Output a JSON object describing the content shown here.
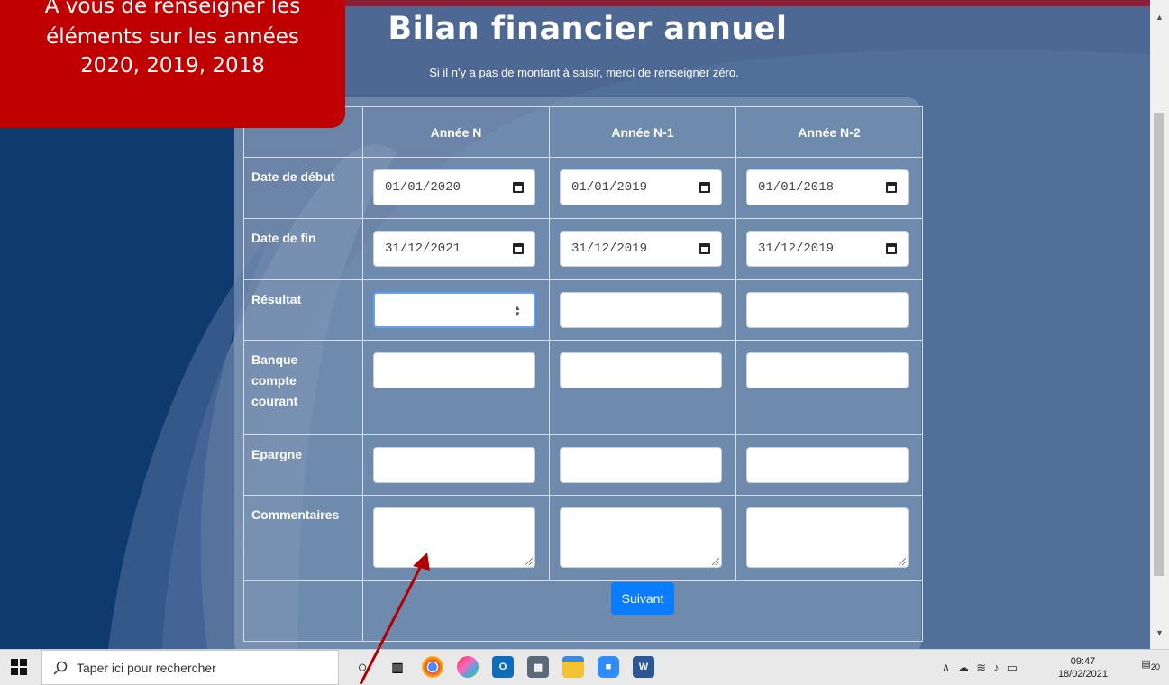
{
  "callout": {
    "lines": [
      "A vous de renseigner les",
      "éléments sur les années",
      "2020, 2019, 2018"
    ]
  },
  "page": {
    "title": "Bilan financier annuel",
    "subtitle": "Si il n'y a pas de montant à saisir, merci de renseigner zéro."
  },
  "table": {
    "headers": [
      "Année N",
      "Année N-1",
      "Année N-2"
    ],
    "rows": {
      "date_debut": {
        "label": "Date de début",
        "values": [
          "01/01/2020",
          "01/01/2019",
          "01/01/2018"
        ]
      },
      "date_fin": {
        "label": "Date de fin",
        "values": [
          "31/12/2021",
          "31/12/2019",
          "31/12/2019"
        ]
      },
      "resultat": {
        "label": "Résultat"
      },
      "banque": {
        "label": "Banque compte courant"
      },
      "epargne": {
        "label": "Epargne"
      },
      "commentaires": {
        "label": "Commentaires"
      }
    },
    "submit_label": "Suivant"
  },
  "taskbar": {
    "search_placeholder": "Taper ici pour rechercher",
    "time": "09:47",
    "date": "18/02/2021",
    "notifications": "20",
    "icons": [
      "windows-start-icon",
      "cortana-icon",
      "task-view-icon",
      "chrome-icon",
      "paint-icon",
      "outlook-icon",
      "calculator-icon",
      "file-explorer-icon",
      "zoom-icon",
      "word-icon"
    ]
  },
  "colors": {
    "accent": "#0a7cff",
    "callout": "#c00000",
    "background": "#4d6893"
  }
}
